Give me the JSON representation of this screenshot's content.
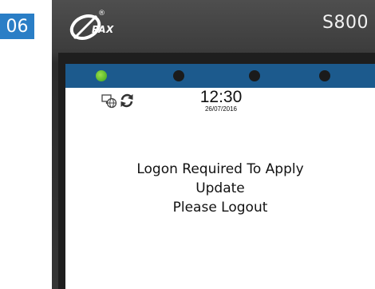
{
  "step_badge": "06",
  "device": {
    "brand": "PAX",
    "brand_mark": "®",
    "model": "S800",
    "leds": [
      {
        "name": "led-1",
        "color": "#3aa21c",
        "on": true
      },
      {
        "name": "led-2",
        "on": false
      },
      {
        "name": "led-3",
        "on": false
      },
      {
        "name": "led-4",
        "on": false
      }
    ]
  },
  "screen": {
    "status_icons": [
      "network-icon",
      "sync-icon"
    ],
    "time": "12:30",
    "date": "26/07/2016",
    "message_lines": [
      "Logon Required To Apply",
      "Update",
      "Please Logout"
    ]
  },
  "colors": {
    "badge": "#2a7ec6",
    "led_bar": "#1c5a8d",
    "device_body": "#353535"
  }
}
